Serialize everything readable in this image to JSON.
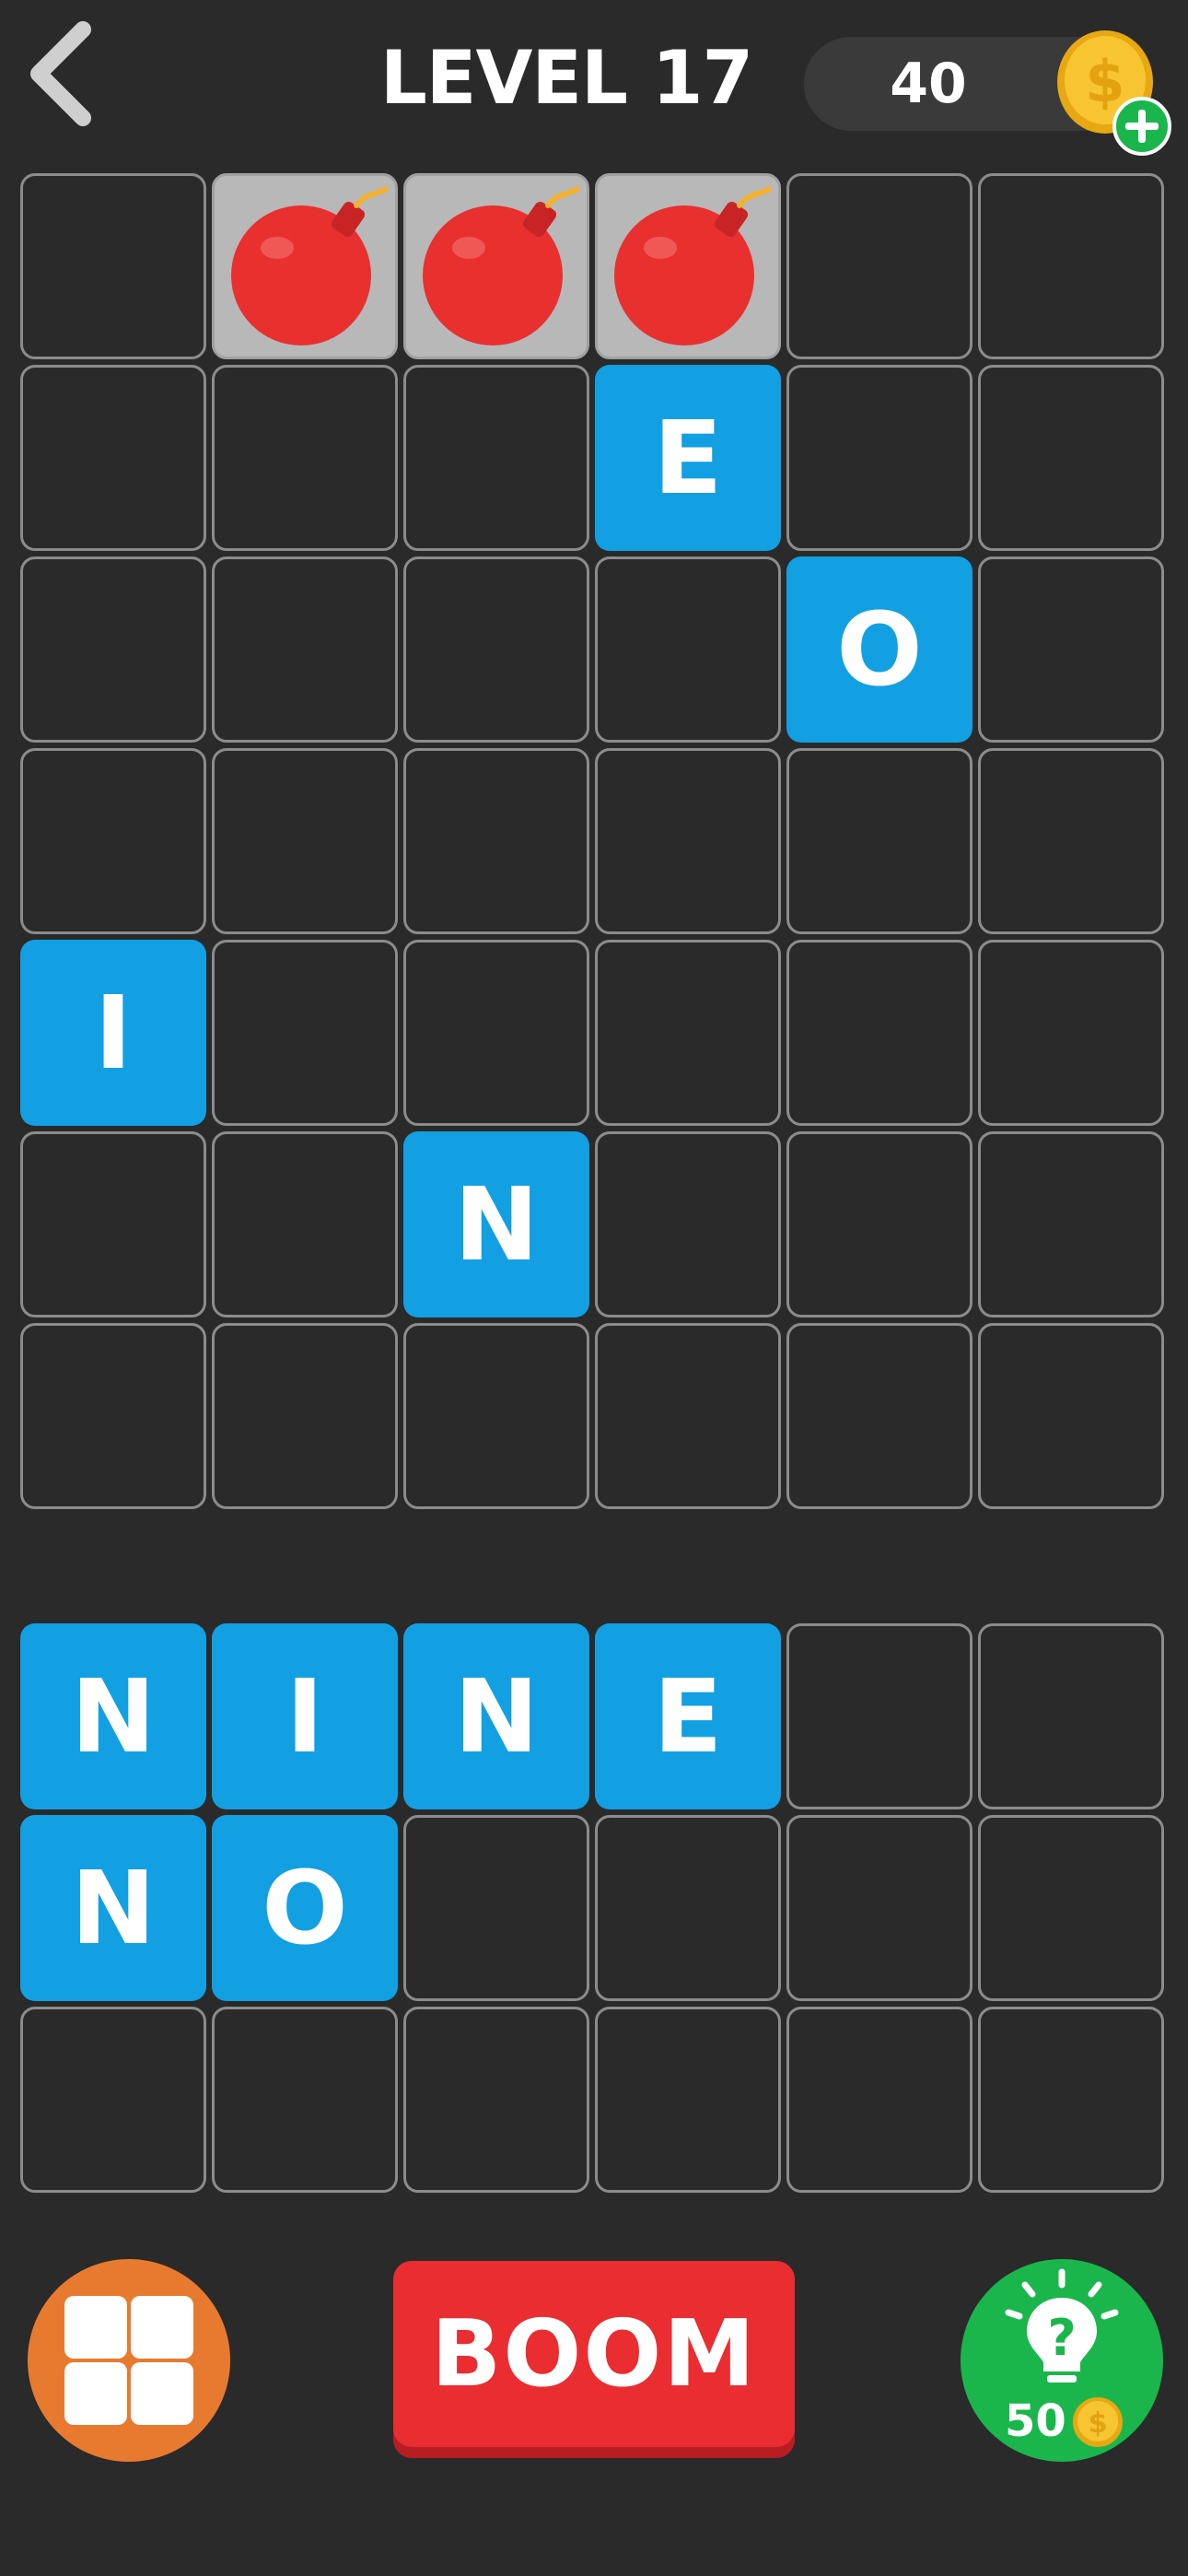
{
  "header": {
    "title": "LEVEL 17",
    "coins": "40"
  },
  "board": {
    "columns": 6,
    "rows": 7,
    "cells": [
      "",
      "bomb",
      "bomb",
      "bomb",
      "",
      "",
      "",
      "",
      "",
      "E",
      "",
      "",
      "",
      "",
      "",
      "",
      "O",
      "",
      "",
      "",
      "",
      "",
      "",
      "",
      "I",
      "",
      "",
      "",
      "",
      "",
      "",
      "",
      "N",
      "",
      "",
      "",
      "",
      "",
      "",
      "",
      "",
      ""
    ]
  },
  "tray": {
    "columns": 6,
    "rows": 3,
    "cells": [
      "N",
      "I",
      "N",
      "E",
      "",
      "",
      "N",
      "O",
      "",
      "",
      "",
      "",
      "",
      "",
      "",
      "",
      "",
      ""
    ]
  },
  "controls": {
    "boom_label": "BOOM",
    "hint_cost": "50"
  },
  "colors": {
    "background": "#2a2a2a",
    "letter_tile": "#12a0e3",
    "bomb_tile": "#b8b8b8",
    "boom_button": "#ea2d31",
    "menu_button": "#e87a30",
    "hint_button": "#1ab64c"
  },
  "icons": {
    "back": "chevron-left-icon",
    "coin": "dollar-coin-icon",
    "add": "plus-icon",
    "bomb": "bomb-icon",
    "menu": "grid-icon",
    "hint": "lightbulb-question-icon"
  }
}
